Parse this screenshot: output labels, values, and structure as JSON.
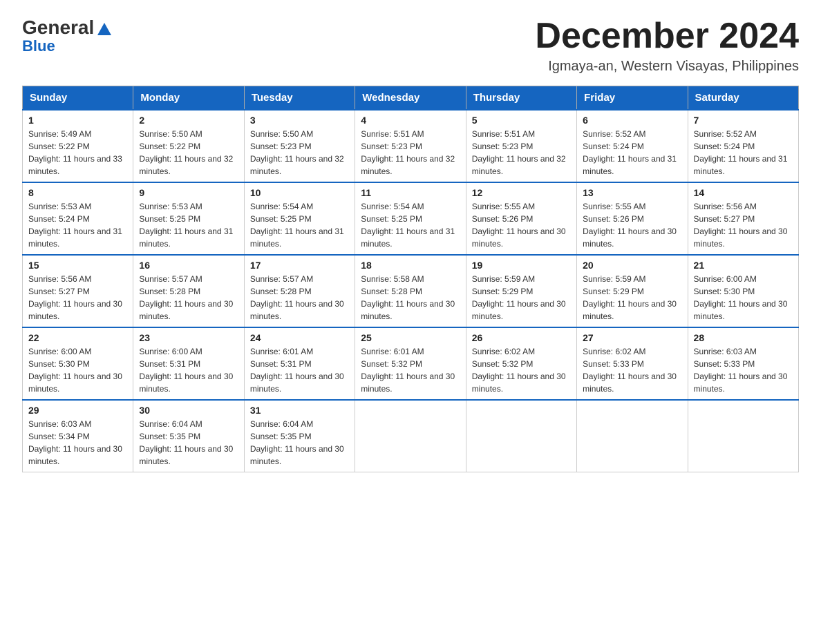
{
  "header": {
    "logo_general": "General",
    "logo_blue": "Blue",
    "month_title": "December 2024",
    "subtitle": "Igmaya-an, Western Visayas, Philippines"
  },
  "calendar": {
    "days_of_week": [
      "Sunday",
      "Monday",
      "Tuesday",
      "Wednesday",
      "Thursday",
      "Friday",
      "Saturday"
    ],
    "weeks": [
      [
        {
          "day": "1",
          "sunrise": "Sunrise: 5:49 AM",
          "sunset": "Sunset: 5:22 PM",
          "daylight": "Daylight: 11 hours and 33 minutes."
        },
        {
          "day": "2",
          "sunrise": "Sunrise: 5:50 AM",
          "sunset": "Sunset: 5:22 PM",
          "daylight": "Daylight: 11 hours and 32 minutes."
        },
        {
          "day": "3",
          "sunrise": "Sunrise: 5:50 AM",
          "sunset": "Sunset: 5:23 PM",
          "daylight": "Daylight: 11 hours and 32 minutes."
        },
        {
          "day": "4",
          "sunrise": "Sunrise: 5:51 AM",
          "sunset": "Sunset: 5:23 PM",
          "daylight": "Daylight: 11 hours and 32 minutes."
        },
        {
          "day": "5",
          "sunrise": "Sunrise: 5:51 AM",
          "sunset": "Sunset: 5:23 PM",
          "daylight": "Daylight: 11 hours and 32 minutes."
        },
        {
          "day": "6",
          "sunrise": "Sunrise: 5:52 AM",
          "sunset": "Sunset: 5:24 PM",
          "daylight": "Daylight: 11 hours and 31 minutes."
        },
        {
          "day": "7",
          "sunrise": "Sunrise: 5:52 AM",
          "sunset": "Sunset: 5:24 PM",
          "daylight": "Daylight: 11 hours and 31 minutes."
        }
      ],
      [
        {
          "day": "8",
          "sunrise": "Sunrise: 5:53 AM",
          "sunset": "Sunset: 5:24 PM",
          "daylight": "Daylight: 11 hours and 31 minutes."
        },
        {
          "day": "9",
          "sunrise": "Sunrise: 5:53 AM",
          "sunset": "Sunset: 5:25 PM",
          "daylight": "Daylight: 11 hours and 31 minutes."
        },
        {
          "day": "10",
          "sunrise": "Sunrise: 5:54 AM",
          "sunset": "Sunset: 5:25 PM",
          "daylight": "Daylight: 11 hours and 31 minutes."
        },
        {
          "day": "11",
          "sunrise": "Sunrise: 5:54 AM",
          "sunset": "Sunset: 5:25 PM",
          "daylight": "Daylight: 11 hours and 31 minutes."
        },
        {
          "day": "12",
          "sunrise": "Sunrise: 5:55 AM",
          "sunset": "Sunset: 5:26 PM",
          "daylight": "Daylight: 11 hours and 30 minutes."
        },
        {
          "day": "13",
          "sunrise": "Sunrise: 5:55 AM",
          "sunset": "Sunset: 5:26 PM",
          "daylight": "Daylight: 11 hours and 30 minutes."
        },
        {
          "day": "14",
          "sunrise": "Sunrise: 5:56 AM",
          "sunset": "Sunset: 5:27 PM",
          "daylight": "Daylight: 11 hours and 30 minutes."
        }
      ],
      [
        {
          "day": "15",
          "sunrise": "Sunrise: 5:56 AM",
          "sunset": "Sunset: 5:27 PM",
          "daylight": "Daylight: 11 hours and 30 minutes."
        },
        {
          "day": "16",
          "sunrise": "Sunrise: 5:57 AM",
          "sunset": "Sunset: 5:28 PM",
          "daylight": "Daylight: 11 hours and 30 minutes."
        },
        {
          "day": "17",
          "sunrise": "Sunrise: 5:57 AM",
          "sunset": "Sunset: 5:28 PM",
          "daylight": "Daylight: 11 hours and 30 minutes."
        },
        {
          "day": "18",
          "sunrise": "Sunrise: 5:58 AM",
          "sunset": "Sunset: 5:28 PM",
          "daylight": "Daylight: 11 hours and 30 minutes."
        },
        {
          "day": "19",
          "sunrise": "Sunrise: 5:59 AM",
          "sunset": "Sunset: 5:29 PM",
          "daylight": "Daylight: 11 hours and 30 minutes."
        },
        {
          "day": "20",
          "sunrise": "Sunrise: 5:59 AM",
          "sunset": "Sunset: 5:29 PM",
          "daylight": "Daylight: 11 hours and 30 minutes."
        },
        {
          "day": "21",
          "sunrise": "Sunrise: 6:00 AM",
          "sunset": "Sunset: 5:30 PM",
          "daylight": "Daylight: 11 hours and 30 minutes."
        }
      ],
      [
        {
          "day": "22",
          "sunrise": "Sunrise: 6:00 AM",
          "sunset": "Sunset: 5:30 PM",
          "daylight": "Daylight: 11 hours and 30 minutes."
        },
        {
          "day": "23",
          "sunrise": "Sunrise: 6:00 AM",
          "sunset": "Sunset: 5:31 PM",
          "daylight": "Daylight: 11 hours and 30 minutes."
        },
        {
          "day": "24",
          "sunrise": "Sunrise: 6:01 AM",
          "sunset": "Sunset: 5:31 PM",
          "daylight": "Daylight: 11 hours and 30 minutes."
        },
        {
          "day": "25",
          "sunrise": "Sunrise: 6:01 AM",
          "sunset": "Sunset: 5:32 PM",
          "daylight": "Daylight: 11 hours and 30 minutes."
        },
        {
          "day": "26",
          "sunrise": "Sunrise: 6:02 AM",
          "sunset": "Sunset: 5:32 PM",
          "daylight": "Daylight: 11 hours and 30 minutes."
        },
        {
          "day": "27",
          "sunrise": "Sunrise: 6:02 AM",
          "sunset": "Sunset: 5:33 PM",
          "daylight": "Daylight: 11 hours and 30 minutes."
        },
        {
          "day": "28",
          "sunrise": "Sunrise: 6:03 AM",
          "sunset": "Sunset: 5:33 PM",
          "daylight": "Daylight: 11 hours and 30 minutes."
        }
      ],
      [
        {
          "day": "29",
          "sunrise": "Sunrise: 6:03 AM",
          "sunset": "Sunset: 5:34 PM",
          "daylight": "Daylight: 11 hours and 30 minutes."
        },
        {
          "day": "30",
          "sunrise": "Sunrise: 6:04 AM",
          "sunset": "Sunset: 5:35 PM",
          "daylight": "Daylight: 11 hours and 30 minutes."
        },
        {
          "day": "31",
          "sunrise": "Sunrise: 6:04 AM",
          "sunset": "Sunset: 5:35 PM",
          "daylight": "Daylight: 11 hours and 30 minutes."
        },
        null,
        null,
        null,
        null
      ]
    ]
  }
}
